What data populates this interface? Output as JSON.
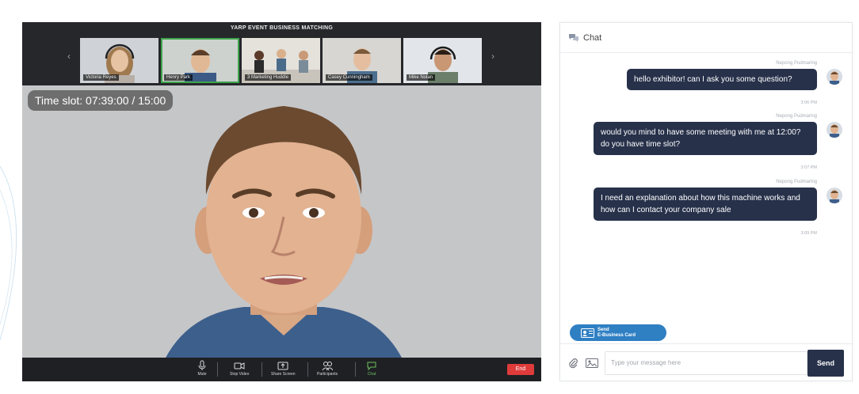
{
  "video": {
    "event_title": "YARP EVENT BUSINESS MATCHING",
    "time_slot": "Time slot: 07:39:00 / 15:00",
    "participants": [
      {
        "name": "Victoria Reyes",
        "active": false
      },
      {
        "name": "Henry Park",
        "active": true
      },
      {
        "name": "3 Marketing Huddle",
        "active": false
      },
      {
        "name": "Casey Cunningham",
        "active": false
      },
      {
        "name": "Mike Nolan",
        "active": false
      }
    ],
    "controls": {
      "mute": "Mute",
      "stop_video": "Stop Video",
      "share_screen": "Share Screen",
      "participants": "Participants",
      "chat": "Chat",
      "end": "End"
    }
  },
  "chat": {
    "title": "Chat",
    "messages": [
      {
        "sender": "Nepong Pudmaring",
        "text": "hello exhibitor! can I ask you some question?",
        "time": "3:06 PM"
      },
      {
        "sender": "Nepong Pudmaring",
        "text": "would you mind to have some meeting with me at 12:00? do you have time slot?",
        "time": "3:07 PM"
      },
      {
        "sender": "Nepong Pudmaring",
        "text": "I need an explanation about how this machine works and how can I contact your company sale",
        "time": "3:09 PM"
      }
    ],
    "send_card": {
      "line1": "Send",
      "line2": "E-Business Card"
    },
    "input_placeholder": "Type your message here",
    "send_label": "Send"
  },
  "colors": {
    "bubble": "#27314a",
    "accent_blue": "#2f7fc3",
    "end_red": "#e03b3b",
    "chat_green": "#6cc15d"
  },
  "icons": [
    "chevron-left-icon",
    "chevron-right-icon",
    "microphone-icon",
    "video-camera-icon",
    "share-screen-icon",
    "participants-icon",
    "chat-bubble-icon",
    "paperclip-icon",
    "image-icon",
    "id-card-icon"
  ]
}
